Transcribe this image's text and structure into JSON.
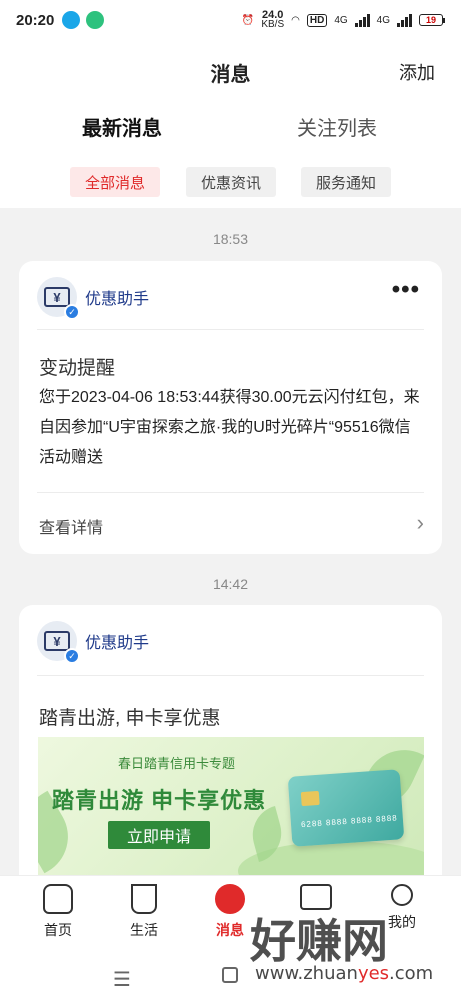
{
  "status_bar": {
    "time": "20:20",
    "net_speed": "24.0",
    "net_unit": "KB/S",
    "hd": "HD",
    "gen1": "4G",
    "gen2": "4G",
    "battery": "19"
  },
  "header": {
    "title": "消息",
    "add_label": "添加",
    "tabs": [
      {
        "label": "最新消息",
        "active": true
      },
      {
        "label": "关注列表",
        "active": false
      }
    ],
    "filters": [
      {
        "label": "全部消息",
        "active": true
      },
      {
        "label": "优惠资讯",
        "active": false
      },
      {
        "label": "服务通知",
        "active": false
      }
    ]
  },
  "feed": [
    {
      "timestamp": "18:53",
      "sender": "优惠助手",
      "more": "•••",
      "title": "变动提醒",
      "body": "您于2023-04-06 18:53:44获得30.00元云闪付红包，来自因参加“U宇宙探索之旅·我的U时光碎片“95516微信活动赠送",
      "detail_label": "查看详情"
    },
    {
      "timestamp": "14:42",
      "sender": "优惠助手",
      "title": "踏青出游, 申卡享优惠",
      "banner": {
        "subtitle": "春日踏青信用卡专题",
        "headline": "踏青出游  申卡享优惠",
        "button": "立即申请",
        "card_number": "6288 8888 8888 8888"
      }
    }
  ],
  "bottom_nav": [
    {
      "label": "首页",
      "icon": "home-icon",
      "active": false
    },
    {
      "label": "生活",
      "icon": "cup-icon",
      "active": false
    },
    {
      "label": "消息",
      "icon": "message-icon",
      "active": true
    },
    {
      "label": "卡管",
      "icon": "card-icon",
      "active": false
    },
    {
      "label": "我的",
      "icon": "user-icon",
      "active": false
    }
  ],
  "system_nav": {
    "menu": "☰"
  },
  "watermark": {
    "text": "好赚网",
    "url_prefix": "www.zhuan",
    "url_accent": "yes",
    "url_suffix": ".com"
  },
  "colors": {
    "accent": "#e02a2a",
    "sender_blue": "#1f3a8a",
    "banner_green": "#2f8a3a"
  }
}
